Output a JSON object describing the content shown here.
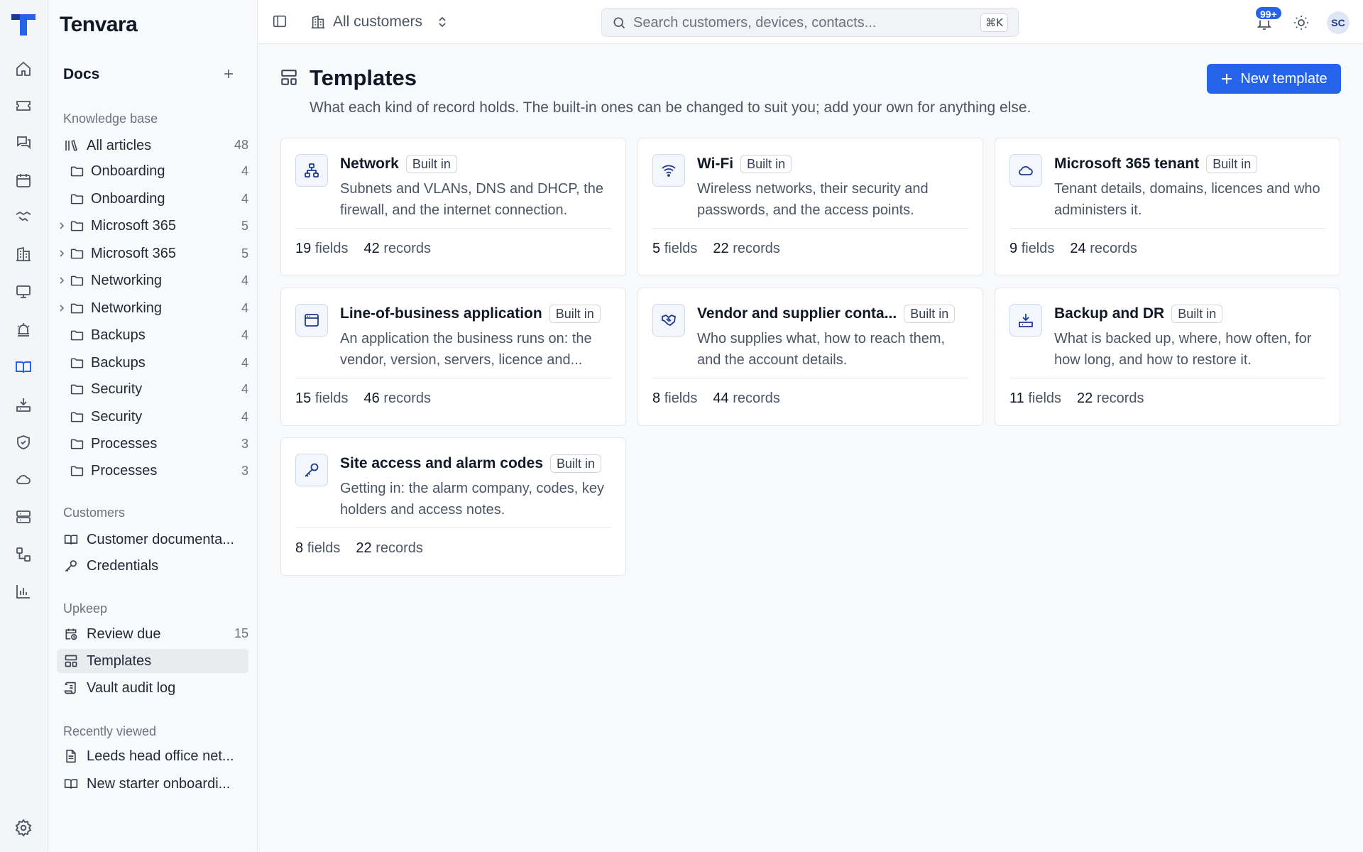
{
  "app": {
    "brand": "Tenvara"
  },
  "sidebar": {
    "docs_title": "Docs",
    "knowledge_label": "Knowledge base",
    "all_articles": {
      "label": "All articles",
      "count": "48"
    },
    "folders": [
      {
        "label": "Onboarding",
        "count": "4",
        "expandable": false
      },
      {
        "label": "Onboarding",
        "count": "4",
        "expandable": false
      },
      {
        "label": "Microsoft 365",
        "count": "5",
        "expandable": true
      },
      {
        "label": "Microsoft 365",
        "count": "5",
        "expandable": true
      },
      {
        "label": "Networking",
        "count": "4",
        "expandable": true
      },
      {
        "label": "Networking",
        "count": "4",
        "expandable": true
      },
      {
        "label": "Backups",
        "count": "4",
        "expandable": false
      },
      {
        "label": "Backups",
        "count": "4",
        "expandable": false
      },
      {
        "label": "Security",
        "count": "4",
        "expandable": false
      },
      {
        "label": "Security",
        "count": "4",
        "expandable": false
      },
      {
        "label": "Processes",
        "count": "3",
        "expandable": false
      },
      {
        "label": "Processes",
        "count": "3",
        "expandable": false
      }
    ],
    "customers_label": "Customers",
    "customers_items": [
      {
        "label": "Customer documenta..."
      },
      {
        "label": "Credentials"
      }
    ],
    "upkeep_label": "Upkeep",
    "upkeep_items": [
      {
        "label": "Review due",
        "count": "15"
      },
      {
        "label": "Templates",
        "count": ""
      },
      {
        "label": "Vault audit log",
        "count": ""
      }
    ],
    "recent_label": "Recently viewed",
    "recent_items": [
      {
        "label": "Leeds head office net..."
      },
      {
        "label": "New starter onboardi..."
      }
    ]
  },
  "topbar": {
    "customer_selector": "All customers",
    "search_placeholder": "Search customers, devices, contacts...",
    "search_shortcut": "⌘K",
    "notification_badge": "99+",
    "avatar_initials": "SC"
  },
  "main": {
    "title": "Templates",
    "subtitle": "What each kind of record holds. The built-in ones can be changed to suit you; add your own for anything else.",
    "new_button": "New template",
    "fields_word": "fields",
    "records_word": "records",
    "cards": [
      {
        "icon": "network-icon",
        "title": "Network",
        "badge": "Built in",
        "desc": "Subnets and VLANs, DNS and DHCP, the firewall, and the internet connection.",
        "fields": "19",
        "records": "42"
      },
      {
        "icon": "wifi-icon",
        "title": "Wi-Fi",
        "badge": "Built in",
        "desc": "Wireless networks, their security and passwords, and the access points.",
        "fields": "5",
        "records": "22"
      },
      {
        "icon": "cloud-icon",
        "title": "Microsoft 365 tenant",
        "badge": "Built in",
        "desc": "Tenant details, domains, licences and who administers it.",
        "fields": "9",
        "records": "24"
      },
      {
        "icon": "app-window-icon",
        "title": "Line-of-business application",
        "badge": "Built in",
        "desc": "An application the business runs on: the vendor, version, servers, licence and...",
        "fields": "15",
        "records": "46"
      },
      {
        "icon": "handshake-icon",
        "title": "Vendor and supplier conta...",
        "badge": "Built in",
        "desc": "Who supplies what, how to reach them, and the account details.",
        "fields": "8",
        "records": "44"
      },
      {
        "icon": "download-drive-icon",
        "title": "Backup and DR",
        "badge": "Built in",
        "desc": "What is backed up, where, how often, for how long, and how to restore it.",
        "fields": "11",
        "records": "22"
      },
      {
        "icon": "key-icon",
        "title": "Site access and alarm codes",
        "badge": "Built in",
        "desc": "Getting in: the alarm company, codes, key holders and access notes.",
        "fields": "8",
        "records": "22"
      }
    ]
  },
  "colors": {
    "accent": "#2563eb",
    "sidebar_bg": "#f8f9fb",
    "active_item": "#e9ebef"
  }
}
